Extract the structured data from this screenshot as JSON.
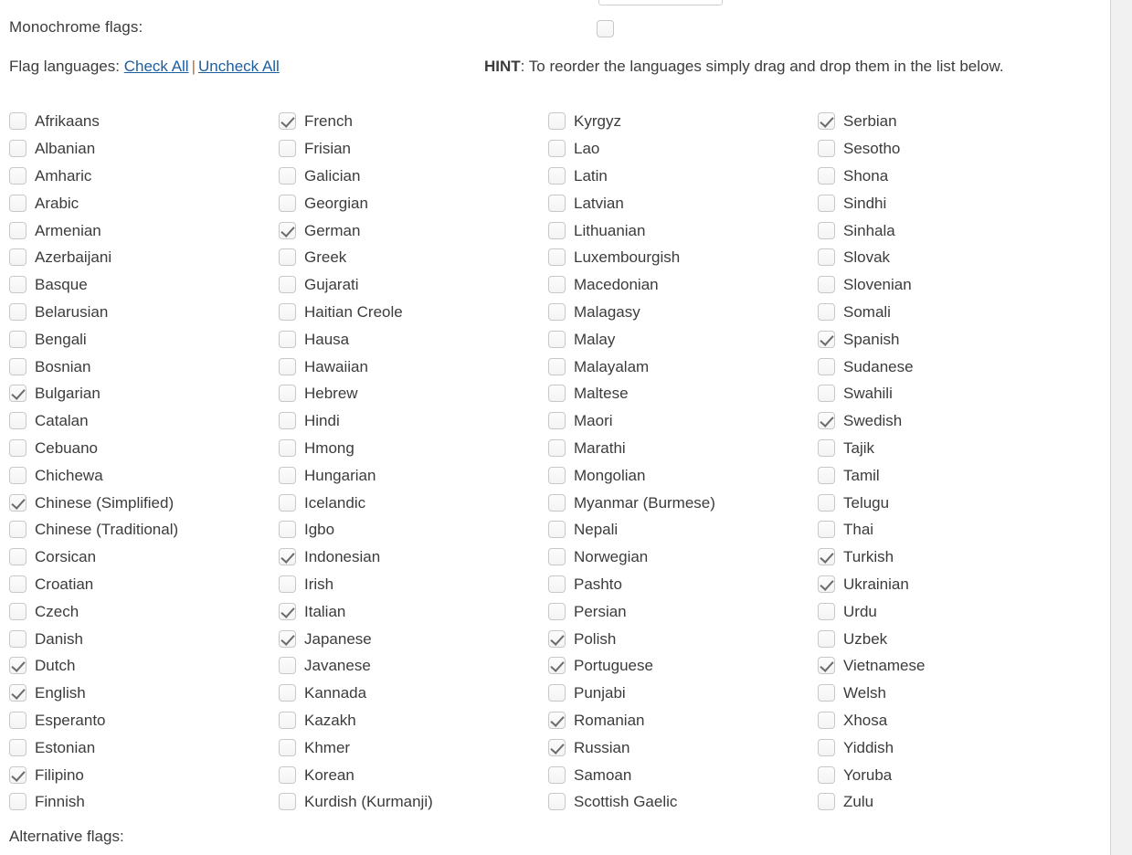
{
  "form": {
    "monochrome_label": "Monochrome flags:",
    "monochrome_checked": false,
    "flag_languages_label": "Flag languages:",
    "check_all_label": "Check All",
    "uncheck_all_label": "Uncheck All",
    "separator": "|",
    "hint_prefix": "HINT",
    "hint_text": ": To reorder the languages simply drag and drop them in the list below.",
    "alternative_flags_label": "Alternative flags:"
  },
  "colors": {
    "link": "#1b5e9e",
    "text": "#3c3c3c",
    "separator": "#c06b2a",
    "checkbox_border": "#c8c8c8",
    "check_mark": "#6b6b6b",
    "scrollbar_track": "#f1f1f1"
  },
  "columns": [
    {
      "items": [
        {
          "label": "Afrikaans",
          "checked": false
        },
        {
          "label": "Albanian",
          "checked": false
        },
        {
          "label": "Amharic",
          "checked": false
        },
        {
          "label": "Arabic",
          "checked": false
        },
        {
          "label": "Armenian",
          "checked": false
        },
        {
          "label": "Azerbaijani",
          "checked": false
        },
        {
          "label": "Basque",
          "checked": false
        },
        {
          "label": "Belarusian",
          "checked": false
        },
        {
          "label": "Bengali",
          "checked": false
        },
        {
          "label": "Bosnian",
          "checked": false
        },
        {
          "label": "Bulgarian",
          "checked": true
        },
        {
          "label": "Catalan",
          "checked": false
        },
        {
          "label": "Cebuano",
          "checked": false
        },
        {
          "label": "Chichewa",
          "checked": false
        },
        {
          "label": "Chinese (Simplified)",
          "checked": true
        },
        {
          "label": "Chinese (Traditional)",
          "checked": false
        },
        {
          "label": "Corsican",
          "checked": false
        },
        {
          "label": "Croatian",
          "checked": false
        },
        {
          "label": "Czech",
          "checked": false
        },
        {
          "label": "Danish",
          "checked": false
        },
        {
          "label": "Dutch",
          "checked": true
        },
        {
          "label": "English",
          "checked": true
        },
        {
          "label": "Esperanto",
          "checked": false
        },
        {
          "label": "Estonian",
          "checked": false
        },
        {
          "label": "Filipino",
          "checked": true
        },
        {
          "label": "Finnish",
          "checked": false
        }
      ]
    },
    {
      "items": [
        {
          "label": "French",
          "checked": true
        },
        {
          "label": "Frisian",
          "checked": false
        },
        {
          "label": "Galician",
          "checked": false
        },
        {
          "label": "Georgian",
          "checked": false
        },
        {
          "label": "German",
          "checked": true
        },
        {
          "label": "Greek",
          "checked": false
        },
        {
          "label": "Gujarati",
          "checked": false
        },
        {
          "label": "Haitian Creole",
          "checked": false
        },
        {
          "label": "Hausa",
          "checked": false
        },
        {
          "label": "Hawaiian",
          "checked": false
        },
        {
          "label": "Hebrew",
          "checked": false
        },
        {
          "label": "Hindi",
          "checked": false
        },
        {
          "label": "Hmong",
          "checked": false
        },
        {
          "label": "Hungarian",
          "checked": false
        },
        {
          "label": "Icelandic",
          "checked": false
        },
        {
          "label": "Igbo",
          "checked": false
        },
        {
          "label": "Indonesian",
          "checked": true
        },
        {
          "label": "Irish",
          "checked": false
        },
        {
          "label": "Italian",
          "checked": true
        },
        {
          "label": "Japanese",
          "checked": true
        },
        {
          "label": "Javanese",
          "checked": false
        },
        {
          "label": "Kannada",
          "checked": false
        },
        {
          "label": "Kazakh",
          "checked": false
        },
        {
          "label": "Khmer",
          "checked": false
        },
        {
          "label": "Korean",
          "checked": false
        },
        {
          "label": "Kurdish (Kurmanji)",
          "checked": false
        }
      ]
    },
    {
      "items": [
        {
          "label": "Kyrgyz",
          "checked": false
        },
        {
          "label": "Lao",
          "checked": false
        },
        {
          "label": "Latin",
          "checked": false
        },
        {
          "label": "Latvian",
          "checked": false
        },
        {
          "label": "Lithuanian",
          "checked": false
        },
        {
          "label": "Luxembourgish",
          "checked": false
        },
        {
          "label": "Macedonian",
          "checked": false
        },
        {
          "label": "Malagasy",
          "checked": false
        },
        {
          "label": "Malay",
          "checked": false
        },
        {
          "label": "Malayalam",
          "checked": false
        },
        {
          "label": "Maltese",
          "checked": false
        },
        {
          "label": "Maori",
          "checked": false
        },
        {
          "label": "Marathi",
          "checked": false
        },
        {
          "label": "Mongolian",
          "checked": false
        },
        {
          "label": "Myanmar (Burmese)",
          "checked": false
        },
        {
          "label": "Nepali",
          "checked": false
        },
        {
          "label": "Norwegian",
          "checked": false
        },
        {
          "label": "Pashto",
          "checked": false
        },
        {
          "label": "Persian",
          "checked": false
        },
        {
          "label": "Polish",
          "checked": true
        },
        {
          "label": "Portuguese",
          "checked": true
        },
        {
          "label": "Punjabi",
          "checked": false
        },
        {
          "label": "Romanian",
          "checked": true
        },
        {
          "label": "Russian",
          "checked": true
        },
        {
          "label": "Samoan",
          "checked": false
        },
        {
          "label": "Scottish Gaelic",
          "checked": false
        }
      ]
    },
    {
      "items": [
        {
          "label": "Serbian",
          "checked": true
        },
        {
          "label": "Sesotho",
          "checked": false
        },
        {
          "label": "Shona",
          "checked": false
        },
        {
          "label": "Sindhi",
          "checked": false
        },
        {
          "label": "Sinhala",
          "checked": false
        },
        {
          "label": "Slovak",
          "checked": false
        },
        {
          "label": "Slovenian",
          "checked": false
        },
        {
          "label": "Somali",
          "checked": false
        },
        {
          "label": "Spanish",
          "checked": true
        },
        {
          "label": "Sudanese",
          "checked": false
        },
        {
          "label": "Swahili",
          "checked": false
        },
        {
          "label": "Swedish",
          "checked": true
        },
        {
          "label": "Tajik",
          "checked": false
        },
        {
          "label": "Tamil",
          "checked": false
        },
        {
          "label": "Telugu",
          "checked": false
        },
        {
          "label": "Thai",
          "checked": false
        },
        {
          "label": "Turkish",
          "checked": true
        },
        {
          "label": "Ukrainian",
          "checked": true
        },
        {
          "label": "Urdu",
          "checked": false
        },
        {
          "label": "Uzbek",
          "checked": false
        },
        {
          "label": "Vietnamese",
          "checked": true
        },
        {
          "label": "Welsh",
          "checked": false
        },
        {
          "label": "Xhosa",
          "checked": false
        },
        {
          "label": "Yiddish",
          "checked": false
        },
        {
          "label": "Yoruba",
          "checked": false
        },
        {
          "label": "Zulu",
          "checked": false
        }
      ]
    }
  ]
}
